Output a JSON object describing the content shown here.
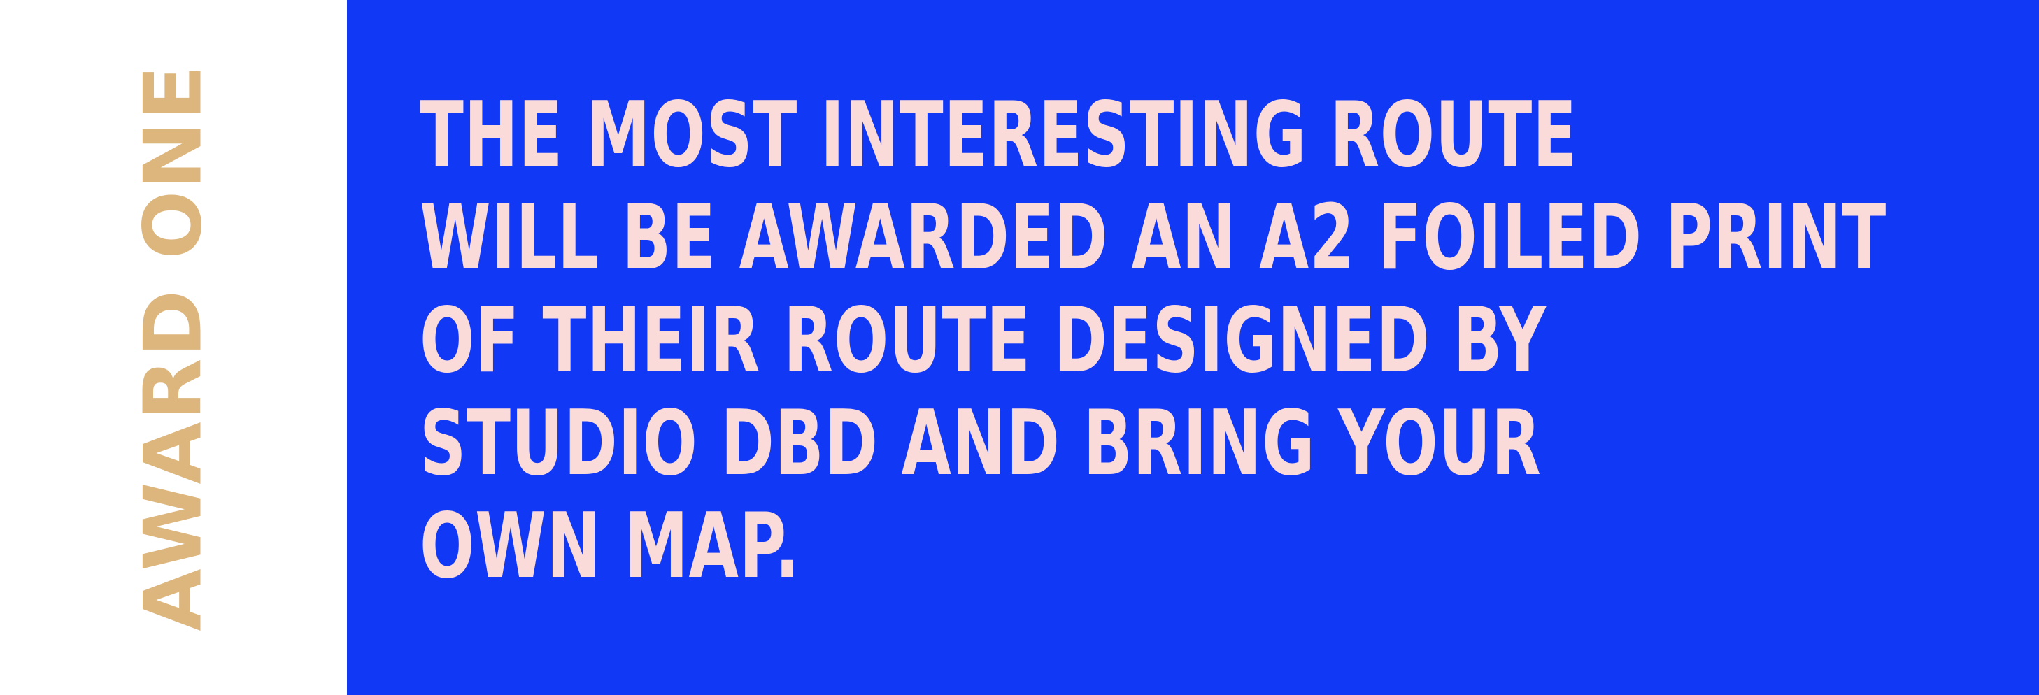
{
  "award": {
    "label": "AWARD ONE"
  },
  "description": {
    "lines": [
      "THE MOST INTERESTING ROUTE",
      "WILL BE AWARDED AN A2 FOILED PRINT",
      "OF THEIR ROUTE DESIGNED BY",
      "STUDIO DBD AND BRING YOUR",
      "OWN MAP."
    ]
  },
  "colors": {
    "page_background": "#FFFFFF",
    "panel_background": "#1139F5",
    "award_label": "#DDB67D",
    "description_text": "#FBDADA"
  }
}
